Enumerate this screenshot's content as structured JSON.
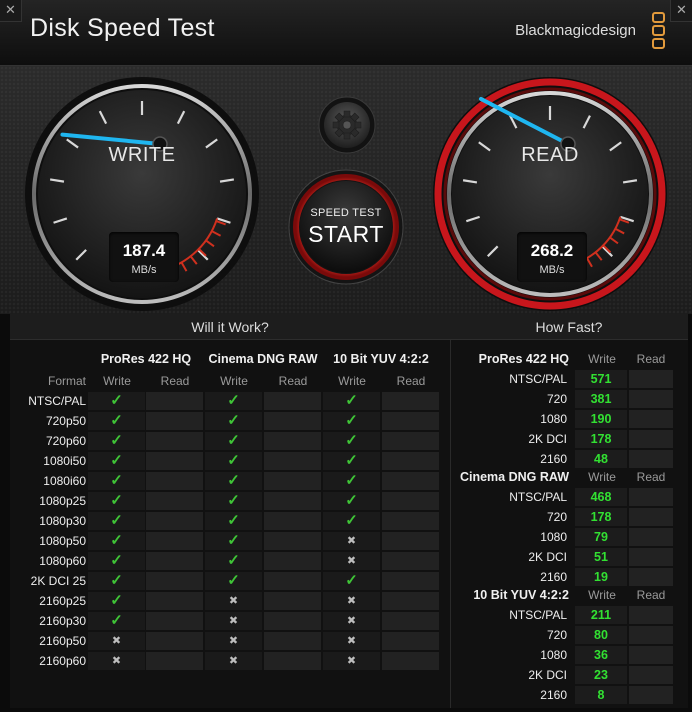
{
  "window": {
    "title": "Disk Speed Test",
    "brand": "Blackmagicdesign",
    "close_glyph": "✕",
    "close_glyph_right": "✕"
  },
  "gauges": {
    "write": {
      "label": "WRITE",
      "value": "187.4",
      "unit": "MB/s",
      "needle_fraction": 0.187
    },
    "read": {
      "label": "READ",
      "value": "268.2",
      "unit": "MB/s",
      "needle_fraction": 0.268
    }
  },
  "controls": {
    "start_small": "SPEED TEST",
    "start_big": "START",
    "settings_icon": "gear-icon"
  },
  "will_it_work": {
    "title": "Will it Work?",
    "format_header": "Format",
    "codecs": [
      {
        "name": "ProRes 422 HQ",
        "write": "Write",
        "read": "Read"
      },
      {
        "name": "Cinema DNG RAW",
        "write": "Write",
        "read": "Read"
      },
      {
        "name": "10 Bit YUV 4:2:2",
        "write": "Write",
        "read": "Read"
      }
    ],
    "rows": [
      {
        "format": "NTSC/PAL",
        "w": [
          "check",
          "check",
          "check"
        ]
      },
      {
        "format": "720p50",
        "w": [
          "check",
          "check",
          "check"
        ]
      },
      {
        "format": "720p60",
        "w": [
          "check",
          "check",
          "check"
        ]
      },
      {
        "format": "1080i50",
        "w": [
          "check",
          "check",
          "check"
        ]
      },
      {
        "format": "1080i60",
        "w": [
          "check",
          "check",
          "check"
        ]
      },
      {
        "format": "1080p25",
        "w": [
          "check",
          "check",
          "check"
        ]
      },
      {
        "format": "1080p30",
        "w": [
          "check",
          "check",
          "check"
        ]
      },
      {
        "format": "1080p50",
        "w": [
          "check",
          "check",
          "cross"
        ]
      },
      {
        "format": "1080p60",
        "w": [
          "check",
          "check",
          "cross"
        ]
      },
      {
        "format": "2K DCI 25",
        "w": [
          "check",
          "check",
          "check"
        ]
      },
      {
        "format": "2160p25",
        "w": [
          "check",
          "cross",
          "cross"
        ]
      },
      {
        "format": "2160p30",
        "w": [
          "check",
          "cross",
          "cross"
        ]
      },
      {
        "format": "2160p50",
        "w": [
          "cross",
          "cross",
          "cross"
        ]
      },
      {
        "format": "2160p60",
        "w": [
          "cross",
          "cross",
          "cross"
        ]
      }
    ],
    "check_glyph": "✓",
    "cross_glyph": "✖"
  },
  "how_fast": {
    "title": "How Fast?",
    "groups": [
      {
        "name": "ProRes 422 HQ",
        "write": "Write",
        "read": "Read",
        "rows": [
          {
            "label": "NTSC/PAL",
            "value": "571"
          },
          {
            "label": "720",
            "value": "381"
          },
          {
            "label": "1080",
            "value": "190"
          },
          {
            "label": "2K DCI",
            "value": "178"
          },
          {
            "label": "2160",
            "value": "48"
          }
        ]
      },
      {
        "name": "Cinema DNG RAW",
        "write": "Write",
        "read": "Read",
        "rows": [
          {
            "label": "NTSC/PAL",
            "value": "468"
          },
          {
            "label": "720",
            "value": "178"
          },
          {
            "label": "1080",
            "value": "79"
          },
          {
            "label": "2K DCI",
            "value": "51"
          },
          {
            "label": "2160",
            "value": "19"
          }
        ]
      },
      {
        "name": "10 Bit YUV 4:2:2",
        "write": "Write",
        "read": "Read",
        "rows": [
          {
            "label": "NTSC/PAL",
            "value": "211"
          },
          {
            "label": "720",
            "value": "80"
          },
          {
            "label": "1080",
            "value": "36"
          },
          {
            "label": "2K DCI",
            "value": "23"
          },
          {
            "label": "2160",
            "value": "8"
          }
        ]
      }
    ]
  },
  "colors": {
    "accent_orange": "#e29a3c",
    "needle_blue": "#1fb6f0",
    "ok_green": "#3fc437",
    "speed_green": "#32e032",
    "red_ring": "#c8161c"
  }
}
